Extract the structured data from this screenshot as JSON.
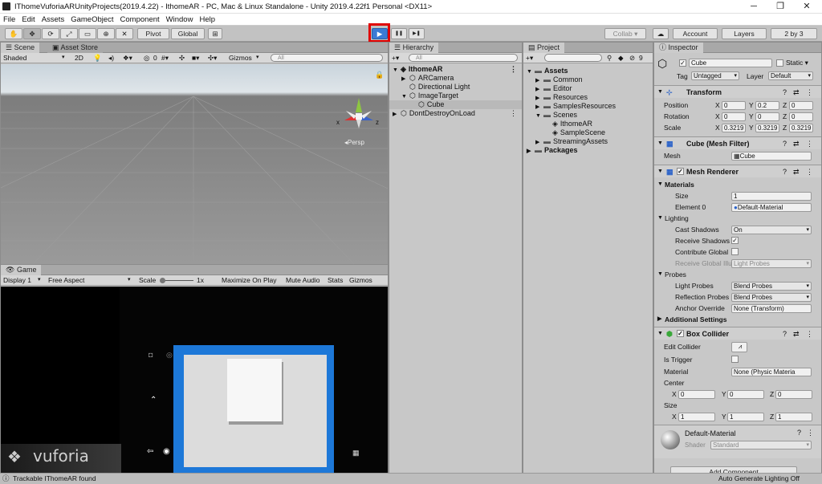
{
  "window": {
    "title": "IThomeVuforiaARUnityProjects(2019.4.22) - IthomeAR - PC, Mac & Linux Standalone - Unity 2019.4.22f1 Personal <DX11>",
    "minimize": "─",
    "maximize": "❐",
    "close": "✕"
  },
  "menu": [
    "File",
    "Edit",
    "Assets",
    "GameObject",
    "Component",
    "Window",
    "Help"
  ],
  "toolbar": {
    "pivot": "Pivot",
    "global": "Global",
    "collab": "Collab ▾",
    "account": "Account",
    "layers": "Layers",
    "layout": "2 by 3",
    "play": "▶",
    "pause": "❚❚",
    "step": "▶❚"
  },
  "scene": {
    "tabs": [
      "Scene",
      "Asset Store"
    ],
    "shading": "Shaded",
    "mode2d": "2D",
    "gizmos": "Gizmos",
    "search": "All",
    "counter": "0",
    "persp": "Persp",
    "axis_x": "x",
    "axis_z": "z"
  },
  "game": {
    "tab": "Game",
    "display": "Display 1",
    "aspect": "Free Aspect",
    "scale_label": "Scale",
    "scale_value": "1x",
    "maximize": "Maximize On Play",
    "mute": "Mute Audio",
    "stats": "Stats",
    "gizmos": "Gizmos",
    "vuforia": "vuforia"
  },
  "hierarchy": {
    "tab": "Hierarchy",
    "search": "All",
    "items": [
      {
        "label": "IthomeAR",
        "depth": 0,
        "bold": true,
        "arrow": "▼"
      },
      {
        "label": "ARCamera",
        "depth": 1,
        "arrow": "▶"
      },
      {
        "label": "Directional Light",
        "depth": 1,
        "arrow": ""
      },
      {
        "label": "ImageTarget",
        "depth": 1,
        "arrow": "▼"
      },
      {
        "label": "Cube",
        "depth": 2,
        "arrow": "",
        "selected": true
      },
      {
        "label": "DontDestroyOnLoad",
        "depth": 0,
        "arrow": "▶"
      }
    ]
  },
  "project": {
    "tab": "Project",
    "count": "9",
    "items": [
      {
        "label": "Assets",
        "depth": 0,
        "bold": true,
        "arrow": "▼"
      },
      {
        "label": "Common",
        "depth": 1,
        "arrow": "▶"
      },
      {
        "label": "Editor",
        "depth": 1,
        "arrow": "▶"
      },
      {
        "label": "Resources",
        "depth": 1,
        "arrow": "▶"
      },
      {
        "label": "SamplesResources",
        "depth": 1,
        "arrow": "▶"
      },
      {
        "label": "Scenes",
        "depth": 1,
        "arrow": "▼"
      },
      {
        "label": "IthomeAR",
        "depth": 2,
        "arrow": "",
        "scene": true
      },
      {
        "label": "SampleScene",
        "depth": 2,
        "arrow": "",
        "scene": true
      },
      {
        "label": "StreamingAssets",
        "depth": 1,
        "arrow": "▶"
      },
      {
        "label": "Packages",
        "depth": 0,
        "bold": true,
        "arrow": "▶"
      }
    ]
  },
  "inspector": {
    "tab": "Inspector",
    "name": "Cube",
    "static": "Static ▾",
    "tag_label": "Tag",
    "tag": "Untagged",
    "layer_label": "Layer",
    "layer": "Default",
    "transform": {
      "title": "Transform",
      "rows": [
        {
          "label": "Position",
          "x": "0",
          "y": "0.2",
          "z": "0"
        },
        {
          "label": "Rotation",
          "x": "0",
          "y": "0",
          "z": "0"
        },
        {
          "label": "Scale",
          "x": "0.3219",
          "y": "0.3219",
          "z": "0.3219"
        }
      ]
    },
    "mesh_filter": {
      "title": "Cube (Mesh Filter)",
      "mesh_label": "Mesh",
      "mesh": "Cube"
    },
    "mesh_renderer": {
      "title": "Mesh Renderer",
      "materials": "Materials",
      "size_label": "Size",
      "size": "1",
      "element0_label": "Element 0",
      "element0": "Default-Material",
      "lighting": "Lighting",
      "cast_label": "Cast Shadows",
      "cast": "On",
      "receive_label": "Receive Shadows",
      "contrib_label": "Contribute Global",
      "receive_gi_label": "Receive Global Illu",
      "receive_gi": "Light Probes",
      "probes": "Probes",
      "light_probes_label": "Light Probes",
      "light_probes": "Blend Probes",
      "refl_label": "Reflection Probes",
      "refl": "Blend Probes",
      "anchor_label": "Anchor Override",
      "anchor": "None (Transform)",
      "additional": "Additional Settings"
    },
    "box_collider": {
      "title": "Box Collider",
      "edit_label": "Edit Collider",
      "trigger_label": "Is Trigger",
      "material_label": "Material",
      "material": "None (Physic Materia",
      "center_label": "Center",
      "center": {
        "x": "0",
        "y": "0",
        "z": "0"
      },
      "size_label": "Size",
      "size": {
        "x": "1",
        "y": "1",
        "z": "1"
      }
    },
    "material": {
      "name": "Default-Material",
      "shader_label": "Shader",
      "shader": "Standard"
    },
    "add_component": "Add Component"
  },
  "status": {
    "left": "Trackable IThomeAR found",
    "right": "Auto Generate Lighting Off"
  },
  "colors": {
    "play_highlight": "#e00000",
    "play_button": "#3a7bd5",
    "selected_row": "#b9b9b9"
  }
}
